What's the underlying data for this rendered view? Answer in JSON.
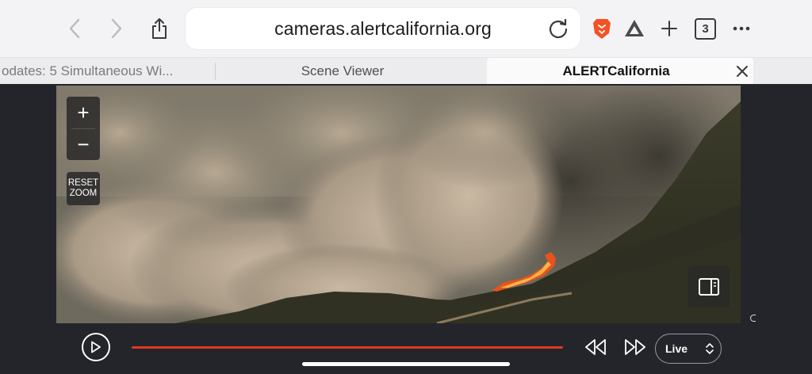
{
  "toolbar": {
    "back_icon": "chevron-left-icon",
    "forward_icon": "chevron-right-icon",
    "share_icon": "share-icon",
    "url": "cameras.alertcalifornia.org",
    "reload_icon": "reload-icon",
    "brave_icon": "brave-lion-icon",
    "triangle_icon": "brave-rewards-icon",
    "new_tab_icon": "plus-icon",
    "tab_count": "3",
    "more_icon": "more-icon"
  },
  "tabs": [
    {
      "label": "odates: 5 Simultaneous Wi..."
    },
    {
      "label": "Scene Viewer"
    },
    {
      "label": "ALERTCalifornia",
      "active": true
    }
  ],
  "viewer": {
    "zoom_in": "+",
    "zoom_out": "−",
    "reset_zoom_line1": "RESET",
    "reset_zoom_line2": "ZOOM",
    "panel_icon": "side-panel-icon"
  },
  "player": {
    "play_icon": "play-icon",
    "progress": 1.0,
    "rewind_icon": "rewind-icon",
    "fast_forward_icon": "fast-forward-icon",
    "mode": "Live",
    "accent_color": "#e03a1f"
  }
}
